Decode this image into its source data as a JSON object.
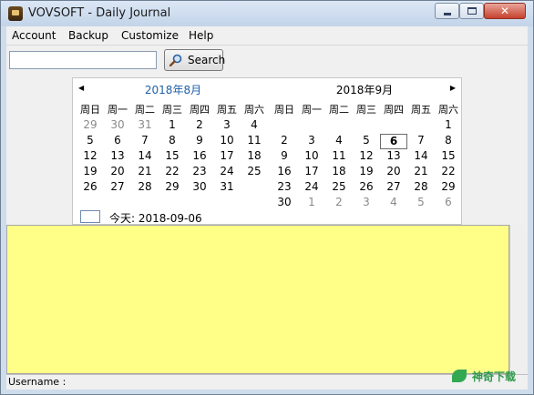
{
  "window": {
    "title": "VOVSOFT - Daily Journal",
    "close_glyph": "✕"
  },
  "menu": [
    "Account",
    "Backup",
    "Customize",
    "Help"
  ],
  "search": {
    "value": "",
    "placeholder": "",
    "button_label": "Search"
  },
  "calendar": {
    "weekday_headers": [
      "周日",
      "周一",
      "周二",
      "周三",
      "周四",
      "周五",
      "周六"
    ],
    "left": {
      "title": "2018年8月",
      "days": [
        [
          "29",
          "30",
          "31",
          "1",
          "2",
          "3",
          "4"
        ],
        [
          "5",
          "6",
          "7",
          "8",
          "9",
          "10",
          "11"
        ],
        [
          "12",
          "13",
          "14",
          "15",
          "16",
          "17",
          "18"
        ],
        [
          "19",
          "20",
          "21",
          "22",
          "23",
          "24",
          "25"
        ],
        [
          "26",
          "27",
          "28",
          "29",
          "30",
          "31",
          ""
        ]
      ],
      "other_month_days": [
        "29",
        "30",
        "31"
      ]
    },
    "right": {
      "title": "2018年9月",
      "days": [
        [
          "",
          "",
          "",
          "",
          "",
          "",
          "1"
        ],
        [
          "2",
          "3",
          "4",
          "5",
          "6",
          "7",
          "8"
        ],
        [
          "9",
          "10",
          "11",
          "12",
          "13",
          "14",
          "15"
        ],
        [
          "16",
          "17",
          "18",
          "19",
          "20",
          "21",
          "22"
        ],
        [
          "23",
          "24",
          "25",
          "26",
          "27",
          "28",
          "29"
        ],
        [
          "30",
          "1",
          "2",
          "3",
          "4",
          "5",
          "6"
        ]
      ],
      "selected_day": "6"
    },
    "today_label": "今天: 2018-09-06"
  },
  "editor": {
    "content": "",
    "background": "#ffff88"
  },
  "status": {
    "text": "Username :"
  },
  "watermark": {
    "text": "神奇下载"
  }
}
